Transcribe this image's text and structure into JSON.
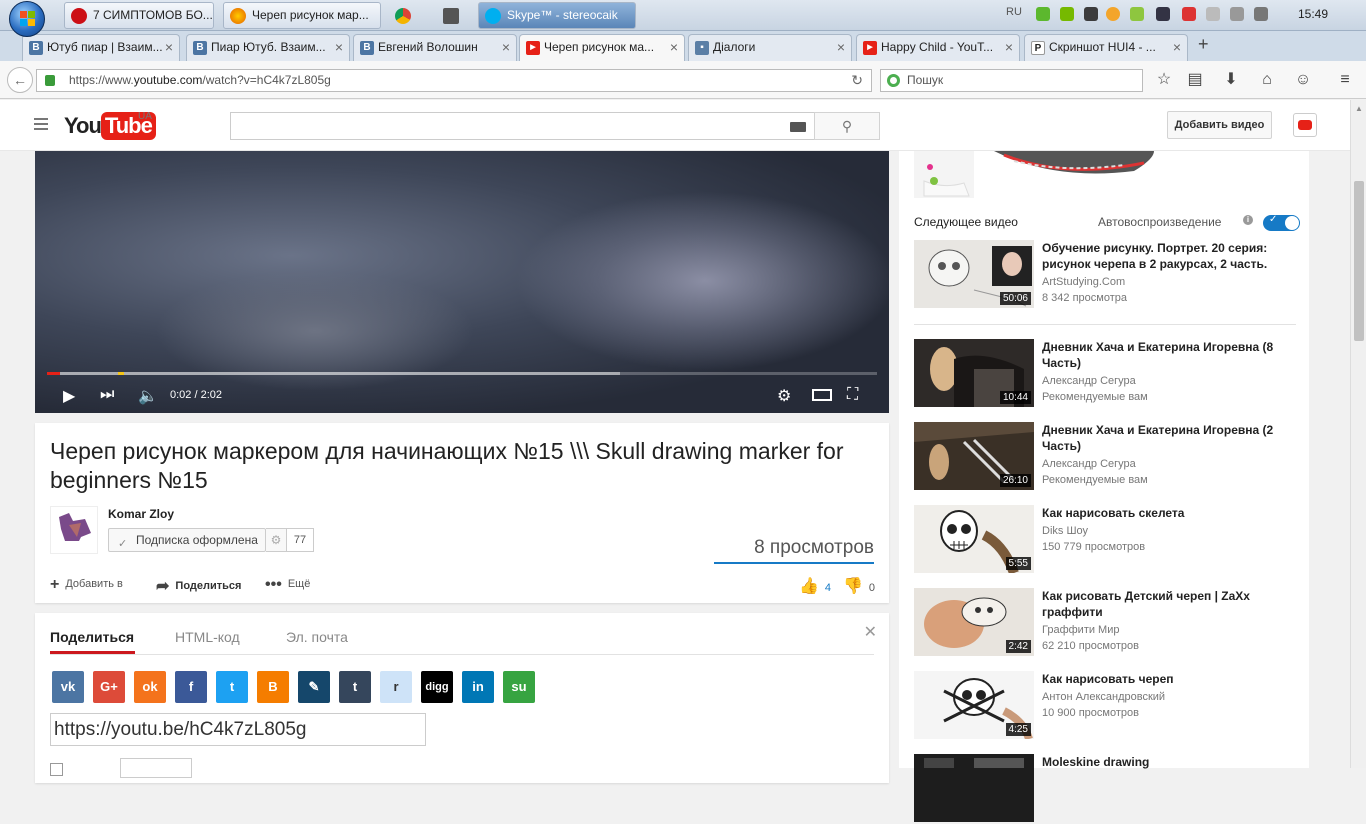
{
  "taskbar": {
    "buttons": [
      {
        "label": "7 СИМПТОМОВ БО..."
      },
      {
        "label": "Череп рисунок мар..."
      },
      {
        "label": ""
      },
      {
        "label": ""
      },
      {
        "label": "Skype™ - stereocaik"
      }
    ],
    "lang": "RU",
    "clock": "15:49"
  },
  "browser": {
    "tabs": [
      {
        "label": "Ютуб пиар | Взаим...",
        "favicon": "B"
      },
      {
        "label": "Пиар Ютуб. Взаим...",
        "favicon": "B"
      },
      {
        "label": "Евгений Волошин",
        "favicon": "B"
      },
      {
        "label": "Череп рисунок ма...",
        "favicon": "▶"
      },
      {
        "label": "Діалоги",
        "favicon": "▪"
      },
      {
        "label": "Happy Child - YouT...",
        "favicon": "▶"
      },
      {
        "label": "Скриншот HUI4 - ...",
        "favicon": "P"
      }
    ],
    "close_glyph": "×",
    "new_tab_glyph": "+",
    "url_plain": "https://www.",
    "url_host": "youtube.com",
    "url_path": "/watch?v=hC4k7zL805g",
    "search_placeholder": "Пошук"
  },
  "youtube": {
    "logo_you": "You",
    "logo_tube": "Tube",
    "logo_region": "UA",
    "upload_label": "Добавить видео",
    "player": {
      "time": "0:02 / 2:02",
      "played_fraction": 0.016,
      "loaded_fraction": 0.69,
      "marker_fraction": 0.085
    },
    "video_title": "Череп рисунок маркером для начинающих №15 \\\\\\ Skull drawing marker for beginners №15",
    "channel_name": "Komar Zloy",
    "subscribed_label": "Подписка оформлена",
    "subscriber_count": "77",
    "views": "8 просмотров",
    "actions": {
      "add_to": "Добавить в",
      "share": "Поделиться",
      "more": "Ещё"
    },
    "likes": "4",
    "dislikes": "0",
    "share_tabs": [
      "Поделиться",
      "HTML-код",
      "Эл. почта"
    ],
    "short_url": "https://youtu.be/hC4k7zL805g",
    "social": [
      {
        "name": "vk",
        "glyph": "vk",
        "color": "#4c75a3"
      },
      {
        "name": "google-plus",
        "glyph": "G+",
        "color": "#dd4b39"
      },
      {
        "name": "odnoklassniki",
        "glyph": "ok",
        "color": "#f4731c"
      },
      {
        "name": "facebook",
        "glyph": "f",
        "color": "#3b5998"
      },
      {
        "name": "twitter",
        "glyph": "t",
        "color": "#1da1f2"
      },
      {
        "name": "blogger",
        "glyph": "B",
        "color": "#f57d00"
      },
      {
        "name": "livejournal",
        "glyph": "✎",
        "color": "#15476b"
      },
      {
        "name": "tumblr",
        "glyph": "t",
        "color": "#35465c"
      },
      {
        "name": "reddit",
        "glyph": "r",
        "color": "#cee3f8"
      },
      {
        "name": "digg",
        "glyph": "digg",
        "color": "#000000"
      },
      {
        "name": "linkedin",
        "glyph": "in",
        "color": "#0077b5"
      },
      {
        "name": "stumbleupon",
        "glyph": "su",
        "color": "#37a441"
      }
    ],
    "sidebar": {
      "next_label": "Следующее видео",
      "autoplay_label": "Автовоспроизведение",
      "videos": [
        {
          "title": "Обучение рисунку. Портрет. 20 серия: рисунок черепа в 2 ракурсах, 2 часть.",
          "channel": "ArtStudying.Com",
          "meta": "8 342 просмотра",
          "duration": "50:06"
        },
        {
          "title": "Дневник Хача и Екатерина Игоревна (8 Часть)",
          "channel": "Александр Сегура",
          "meta": "Рекомендуемые вам",
          "duration": "10:44"
        },
        {
          "title": "Дневник Хача и Екатерина Игоревна (2 Часть)",
          "channel": "Александр Сегура",
          "meta": "Рекомендуемые вам",
          "duration": "26:10"
        },
        {
          "title": "Как нарисовать скелета",
          "channel": "Diks Шоу",
          "meta": "150 779 просмотров",
          "duration": "5:55"
        },
        {
          "title": "Как рисовать Детский череп | ZaXx граффити",
          "channel": "Граффити Мир",
          "meta": "62 210 просмотров",
          "duration": "2:42"
        },
        {
          "title": "Как нарисовать череп",
          "channel": "Антон Александровский",
          "meta": "10 900 просмотров",
          "duration": "4:25"
        },
        {
          "title": "Moleskine drawing",
          "channel": "",
          "meta": "",
          "duration": ""
        }
      ]
    }
  }
}
